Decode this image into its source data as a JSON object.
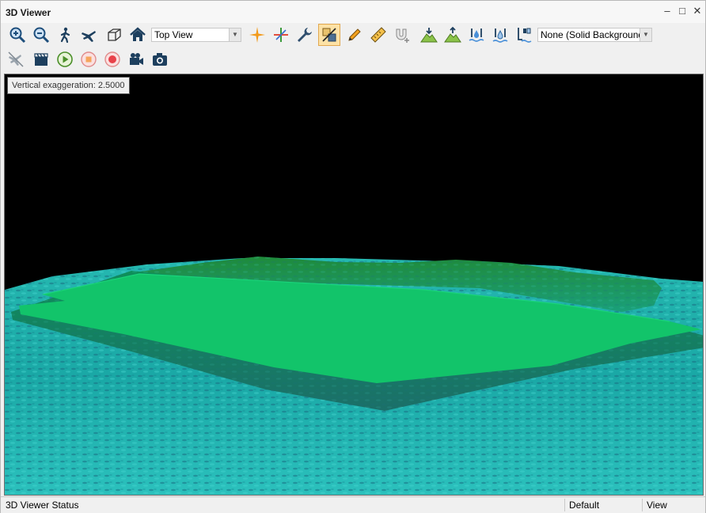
{
  "window": {
    "title": "3D Viewer"
  },
  "toolbar1": {
    "buttons": [
      {
        "icon": "zoom-in-icon"
      },
      {
        "icon": "zoom-out-icon"
      },
      {
        "icon": "walk-icon"
      },
      {
        "icon": "fly-icon"
      },
      {
        "icon": "bounding-box-icon"
      },
      {
        "icon": "home-icon"
      },
      {
        "icon": "crosshair-icon"
      },
      {
        "icon": "axis-icon"
      },
      {
        "icon": "wrench-icon"
      },
      {
        "icon": "vertical-exaggeration-icon",
        "active": true
      },
      {
        "icon": "pencil-icon"
      },
      {
        "icon": "ruler-icon"
      },
      {
        "icon": "magnet-icon"
      },
      {
        "icon": "terrain-down-icon"
      },
      {
        "icon": "terrain-up-icon"
      },
      {
        "icon": "water-level-icon"
      },
      {
        "icon": "water-drop-icon"
      },
      {
        "icon": "depth-marker-icon"
      }
    ],
    "view_select": "Top View",
    "background_select": "None (Solid Background"
  },
  "toolbar2": {
    "buttons": [
      {
        "icon": "flight-path-icon"
      },
      {
        "icon": "clapperboard-icon"
      },
      {
        "icon": "play-icon"
      },
      {
        "icon": "stop-icon"
      },
      {
        "icon": "record-icon"
      },
      {
        "icon": "video-camera-icon"
      },
      {
        "icon": "camera-icon"
      }
    ]
  },
  "tooltip": "Vertical exaggeration: 2.5000",
  "status": {
    "left": "3D Viewer Status",
    "middle": "Default",
    "right": "View"
  },
  "colors": {
    "platform": "#12c46a",
    "seafloor": "#1aa7a0",
    "sky": "#000000",
    "accent_active": "#fde2a6"
  }
}
